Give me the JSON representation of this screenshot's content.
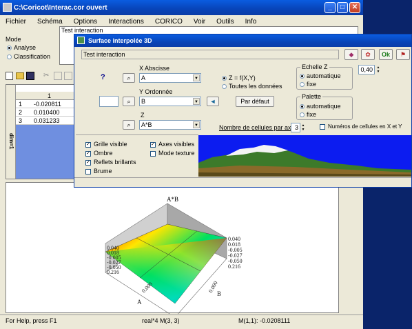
{
  "main_window": {
    "title": "C:\\Coricot\\Interac.cor  ouvert",
    "menu": [
      "Fichier",
      "Schéma",
      "Options",
      "Interactions",
      "CORICO",
      "Voir",
      "Outils",
      "Info"
    ],
    "tab_label": "Test interaction",
    "mode_label": "Mode",
    "mode_options": [
      {
        "label": "Analyse",
        "selected": true
      },
      {
        "label": "Classification",
        "selected": false
      }
    ]
  },
  "table": {
    "side_label": "dim=1",
    "col_header": "1",
    "rows": [
      {
        "idx": "1",
        "val": "-0.020811"
      },
      {
        "idx": "2",
        "val": "0.010400"
      },
      {
        "idx": "3",
        "val": "0.031233"
      }
    ]
  },
  "dialog": {
    "title": "Surface interpolée 3D",
    "name_field": "Test interaction",
    "question_mark": "?",
    "x_label": "X Abscisse",
    "x_value": "A",
    "y_label": "Y Ordonnée",
    "y_value": "B",
    "z_label": "Z",
    "z_value": "A*B",
    "z_mode": [
      {
        "label": "Z = f(X,Y)",
        "selected": true
      },
      {
        "label": "Toutes les données",
        "selected": false
      }
    ],
    "default_button": "Par défaut",
    "cells_label": "Nombre de cellules par axe",
    "cells_value": "3",
    "echelle_title": "Echelle Z",
    "echelle_opts": [
      {
        "label": "automatique",
        "selected": true
      },
      {
        "label": "fixe",
        "selected": false
      }
    ],
    "echelle_value": "0,40",
    "palette_title": "Palette",
    "palette_opts": [
      {
        "label": "automatique",
        "selected": true
      },
      {
        "label": "fixe",
        "selected": false
      }
    ],
    "cell_numbers": "Numéros de cellules en X et Y",
    "ok_label": "Ok",
    "checks": [
      {
        "label": "Grille visible",
        "checked": true
      },
      {
        "label": "Ombre",
        "checked": true
      },
      {
        "label": "Reflets brillants",
        "checked": true
      },
      {
        "label": "Brume",
        "checked": false
      }
    ],
    "checks2": [
      {
        "label": "Axes visibles",
        "checked": true
      },
      {
        "label": "Mode texture",
        "checked": false
      }
    ]
  },
  "plot": {
    "z_title": "A*B",
    "left_ticks": [
      "0.040",
      "0.018",
      "-0.005",
      "-0.027",
      "-0.050",
      "0.216"
    ],
    "right_ticks": [
      "0.040",
      "0.018",
      "-0.005",
      "-0.027",
      "-0.050",
      "0.216"
    ],
    "axis_a": "A",
    "axis_b": "B",
    "a_tick": "0.000",
    "b_tick": "0.000"
  },
  "status": {
    "help": "For Help, press F1",
    "mid": "real*4 M(3, 3)",
    "right": "M(1,1): -0.0208111"
  }
}
